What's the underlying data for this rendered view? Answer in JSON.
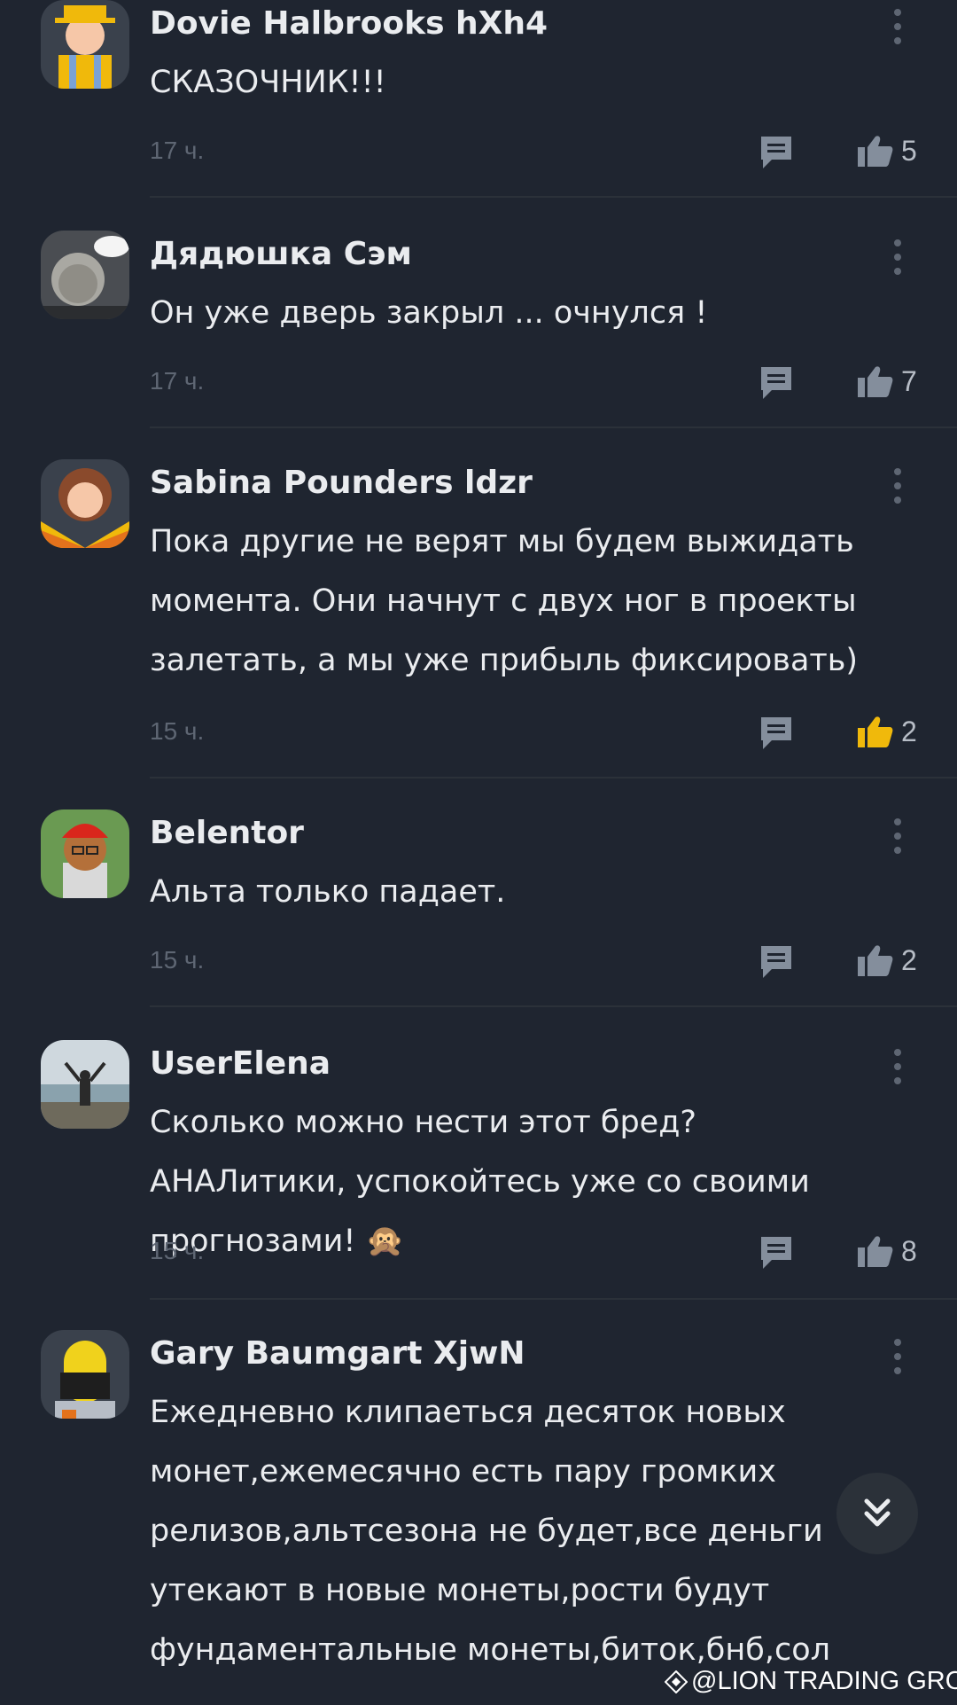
{
  "comments": [
    {
      "author": "Dovie Halbrooks hXh4",
      "text": "СКАЗОЧНИК!!!",
      "time": "17 ч.",
      "likes": "5",
      "liked": false,
      "avatar": "hat-avatar"
    },
    {
      "author": "Дядюшка Сэм",
      "text": "Он уже дверь закрыл ... очнулся !",
      "time": "17 ч.",
      "likes": "7",
      "liked": false,
      "avatar": "photo-baby-avatar"
    },
    {
      "author": "Sabina Pounders ldzr",
      "text": "Пока другие не верят мы будем выжидать момента. Они начнут с двух ног в проекты залетать, а мы уже прибыль фиксировать)",
      "time": "15 ч.",
      "likes": "2",
      "liked": true,
      "avatar": "girl-avatar"
    },
    {
      "author": "Belentor",
      "text": "Альта только падает.",
      "time": "15 ч.",
      "likes": "2",
      "liked": false,
      "avatar": "dog-avatar"
    },
    {
      "author": "UserElena",
      "text": "Сколько можно нести этот бред? АНАЛитики, успокойтесь уже со своими прогнозами! 🙊",
      "time": "15 ч.",
      "likes": "8",
      "liked": false,
      "avatar": "beach-photo-avatar"
    },
    {
      "author": "Gary Baumgart XjwN",
      "text": "Ежедневно клипаеться десяток новых монет,ежемесячно есть пару громких релизов,альтсезона не будет,все деньги утекают в новые монеты,рости будут фундаментальные монеты,биток,бнб,сол",
      "time": "",
      "likes": "",
      "liked": false,
      "avatar": "astronaut-avatar"
    }
  ],
  "watermark": "@LION TRADING GROUP",
  "colors": {
    "background": "#1f2530",
    "liked": "#f0b90b",
    "icon": "#848e9c",
    "muted": "#5e6673"
  }
}
